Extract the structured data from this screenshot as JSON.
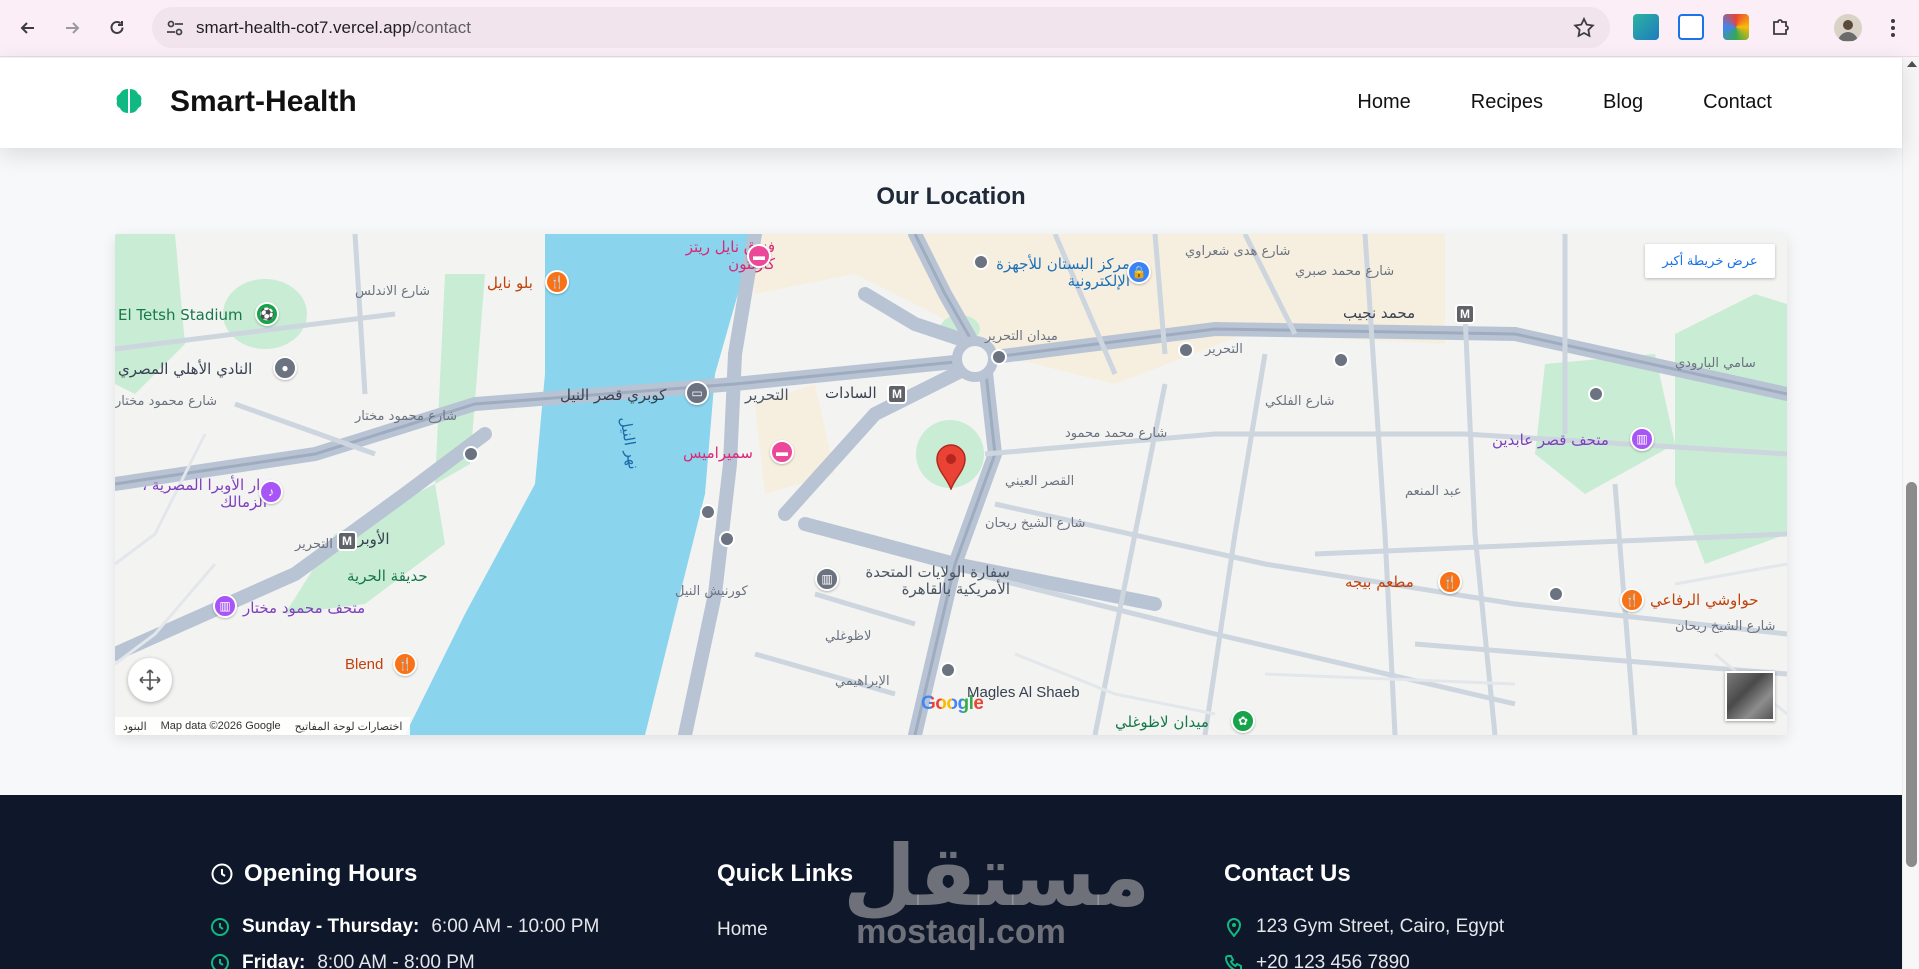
{
  "browser": {
    "url_host": "smart-health-cot7.vercel.app",
    "url_path": "/contact"
  },
  "site": {
    "brand": "Smart-Health",
    "nav": [
      {
        "label": "Home"
      },
      {
        "label": "Recipes"
      },
      {
        "label": "Blog"
      },
      {
        "label": "Contact"
      }
    ]
  },
  "location": {
    "title": "Our Location",
    "map": {
      "view_larger": "عرض خريطة أكبر",
      "attribution": "Map data ©2026 Google",
      "shortcuts": "اختصارات لوحة المفاتيح",
      "terms": "البنود",
      "google": "Google",
      "labels": {
        "tetsh": "El Tetsh Stadium",
        "ahly": "النادي الأهلي المصري",
        "bolo": "بلو نايل",
        "nile_ritz": "فندق نايل ريتز كارلتون",
        "bustan": "مركز البستان للأجهزة الإلكترونية",
        "naguib": "محمد نجيب",
        "qasr_bridge": "كوبري قصر النيل",
        "sadat": "السادات",
        "tahrir": "التحرير",
        "semiramis": "سميراميس",
        "nile_river": "نهر النيل",
        "opera_house": "دار الأوبرا المصرية ، الزمالك",
        "opera_metro": "الأوبرا",
        "horreya": "حديقة الحرية",
        "mokhtar": "متحف محمود مختار",
        "blend": "Blend",
        "us_embassy": "سفارة الولايات المتحدة الأمريكية بالقاهرة",
        "magles": "Magles Al Shaeb",
        "abdeen": "متحف قصر عابدين",
        "bigga": "مطعم بيجه",
        "hawawshi": "حواوشي الرفاعي",
        "lazoghly": "ميدان لاظوغلي",
        "mohamed_mahmoud": "شارع محمد محمود",
        "sheikh_rehan": "شارع الشيخ ريحان",
        "sheikh_rehan_2": "شارع الشيخ ريحان",
        "tahrir_st": "التحرير",
        "tahrir_st2": "التحرير",
        "sami_baroudi": "سامي البارودي",
        "abdel_moneim": "عبد المنعم",
        "andalus": "شارع الاندلس",
        "mahmoud_mokhtar_st": "شارع محمود مختار",
        "mahmoud_mokhtar_st2": "شارع محمود مختار",
        "qasr_nile": "كورنيش النيل",
        "tahrir_sq": "ميدان التحرير",
        "qasr_aini": "القصر العيني",
        "lazoghly_st": "لاظوغلي",
        "ibrahimi": "الإبراهيمي",
        "falaki": "شارع الفلكي",
        "hoda": "شارع هدى شعراوي",
        "sherif": "شارع محمد صبري"
      }
    }
  },
  "footer": {
    "opening": {
      "heading": "Opening Hours",
      "rows": [
        {
          "day": "Sunday - Thursday:",
          "hours": "6:00 AM - 10:00 PM"
        },
        {
          "day": "Friday:",
          "hours": "8:00 AM - 8:00 PM"
        }
      ]
    },
    "links": {
      "heading": "Quick Links",
      "items": [
        {
          "label": "Home"
        }
      ]
    },
    "contact": {
      "heading": "Contact Us",
      "address": "123 Gym Street, Cairo, Egypt",
      "phone": "+20 123 456 7890"
    },
    "watermark": {
      "ar": "مستقل",
      "en": "mostaql.com"
    }
  },
  "colors": {
    "brand_green": "#10b981",
    "footer_bg": "#0f172a",
    "river": "#8ad4ed",
    "park": "#b7e4c7"
  }
}
